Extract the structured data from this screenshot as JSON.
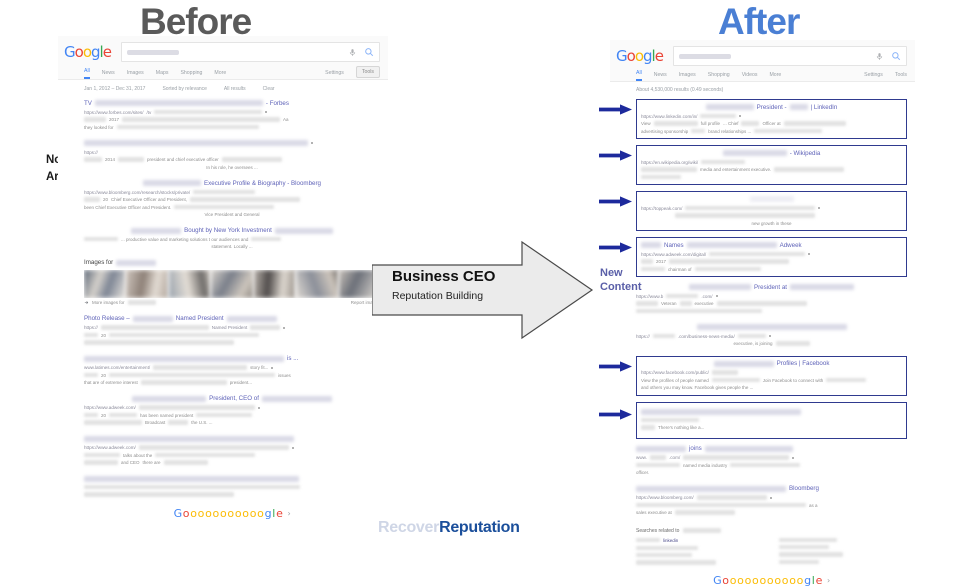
{
  "headings": {
    "before": "Before",
    "after": "After"
  },
  "colors": {
    "before_title": "#5a5a5a",
    "after_title": "#4a7fd4",
    "highlight_box": "#2f3a8f",
    "arrow_blue": "#1d2a9c",
    "new_content_text": "#5a5fa8",
    "brand_light": "#cfd6e6",
    "brand_dark": "#1b4f9b",
    "google_blue": "#4285f4",
    "google_red": "#ea4335",
    "google_yellow": "#fbbc05",
    "google_green": "#34a853"
  },
  "annotations": {
    "no_wiki": "No Wiki\nArticle",
    "no_wiki_line1": "No Wiki",
    "no_wiki_line2": "Article",
    "new_content_line1": "New",
    "new_content_line2": "Content",
    "process_title": "Business CEO",
    "process_subtitle": "Reputation Building"
  },
  "brand": {
    "part1": "Recover",
    "part2": "Reputation"
  },
  "google_logo_letters": [
    "G",
    "o",
    "o",
    "g",
    "l",
    "e"
  ],
  "before_serp": {
    "search_query_placeholder": "",
    "icons": [
      "mic-icon",
      "search-icon"
    ],
    "tabs": [
      "All",
      "News",
      "Images",
      "Maps",
      "Shopping",
      "More"
    ],
    "active_tab": "All",
    "right_tabs": [
      "Settings",
      "Tools"
    ],
    "filters": [
      "Jan 1, 2012 – Dec 31, 2017",
      "Sorted by relevance",
      "All results",
      "Clear"
    ],
    "results": [
      {
        "title_prefix": "TV",
        "title_suffix": "- Forbes",
        "url": "https://www.forbes.com/sites/",
        "url_suffix": "/tv",
        "snippet_bits": [
          "2017",
          "Aa"
        ],
        "extra_line": "they looked for"
      },
      {
        "title_prefix": "",
        "title_suffix": "",
        "url": "https://",
        "url_suffix": "",
        "snippet_bits": [
          "2014",
          "president and chief executive officer"
        ],
        "extra_line": "In his role, he oversees ..."
      },
      {
        "title_prefix": "",
        "title_suffix": "Executive Profile & Biography - Bloomberg",
        "url": "https://www.bloomberg.com/research/stocks/private/",
        "url_suffix": "",
        "snippet_bits": [
          "20",
          "Chief Executive Officer and President,"
        ],
        "extra_line": "been Chief Executive Officer and President.",
        "extra_line2": "Vice President and General"
      },
      {
        "title_prefix": "",
        "title_suffix": "Bought by New York Investment",
        "url": "",
        "url_suffix": "",
        "snippet_bits": [
          "... productive value and marketing solutions t our audiences and"
        ],
        "extra_line": "statement. Locally ..."
      }
    ],
    "images_block": {
      "label": "Images for",
      "more_label": "More images for",
      "report_label": "Report images"
    },
    "results_bottom": [
      {
        "title_prefix": "Photo Release –",
        "title_mid": "Named President",
        "url": "https://",
        "url_inline": "Named President",
        "snippet_bits": [
          "20"
        ]
      },
      {
        "title_suffix": "is ...",
        "url": "www.latimes.com/entertainment/",
        "snippet_bits": [
          "story fit...",
          "issues",
          "20"
        ],
        "extra_line": "that are of extreme interest",
        "extra_line2": "president..."
      },
      {
        "title_mid": "President, CEO of",
        "url": "https://www.adweek.com/",
        "snippet_bits": [
          "20",
          "has been named president"
        ],
        "extra_line": "Broadcast",
        "extra_line2": "the U.S. ..."
      },
      {
        "url": "https://www.adweek.com/",
        "snippet_bits": [
          "talks about the",
          "and CEO",
          "there are"
        ]
      },
      {
        "url": "",
        "snippet_bits": []
      }
    ],
    "pagination_text": "Gooooooooooogle"
  },
  "after_serp": {
    "tabs": [
      "All",
      "News",
      "Images",
      "Shopping",
      "Videos",
      "More"
    ],
    "active_tab": "All",
    "right_tabs": [
      "Settings",
      "Tools"
    ],
    "result_count": "About 4,530,000 results (0.49 seconds)",
    "results": [
      {
        "highlighted": true,
        "title_mid": "President -",
        "title_suffix": "| LinkedIn",
        "url": "https://www.linkedin.com/in/",
        "snippet_bits": [
          "View",
          "full profile",
          "... Chief",
          "Officer at",
          "advertising sponsorship",
          "brand relationships ..."
        ]
      },
      {
        "highlighted": true,
        "title_suffix": "- Wikipedia",
        "url": "https://en.wikipedia.org/wiki/",
        "snippet_bits": [
          "media and entertainment executive."
        ]
      },
      {
        "highlighted": true,
        "title_suffix": "",
        "url": "https://toppeak.com/",
        "snippet_bits": [
          "new growth in these"
        ]
      },
      {
        "highlighted": true,
        "title_prefix": "Names",
        "title_suffix": "Adweek",
        "url": "https://www.adweek.com/digital/",
        "snippet_bits": [
          "2017",
          "chairman of"
        ]
      },
      {
        "highlighted": false,
        "title_mid": "President at",
        "url": "https://www.b",
        "url_suffix": ".com/",
        "snippet_bits": [
          "Veteran",
          "executive"
        ]
      },
      {
        "highlighted": false,
        "title_suffix": "",
        "url": "https://",
        "url_suffix": ".com/business-news-media/",
        "snippet_bits": [
          "executive, is joining"
        ]
      },
      {
        "highlighted": true,
        "title_mid": "Profiles | Facebook",
        "url": "https://www.facebook.com/public/",
        "snippet_bits": [
          "View the profiles of people named",
          "Join Facebook to connect with",
          "and others you may know. Facebook gives people the ..."
        ]
      },
      {
        "highlighted": true,
        "title_suffix": "",
        "url": "",
        "snippet_bits": [
          "There's nothing like a..."
        ]
      },
      {
        "highlighted": false,
        "title_mid": "joins",
        "url": "www.",
        "url_suffix": ".com/",
        "snippet_bits": [
          "named media industry",
          "officer."
        ]
      },
      {
        "highlighted": false,
        "title_suffix": "Bloomberg",
        "url": "https://www.bloomberg.com/",
        "snippet_bits": [
          "as a",
          "sales executive at"
        ]
      }
    ],
    "related_label": "Searches related to",
    "related_highlight": "linkedin",
    "pagination_text": "Gooooooooooogle"
  }
}
